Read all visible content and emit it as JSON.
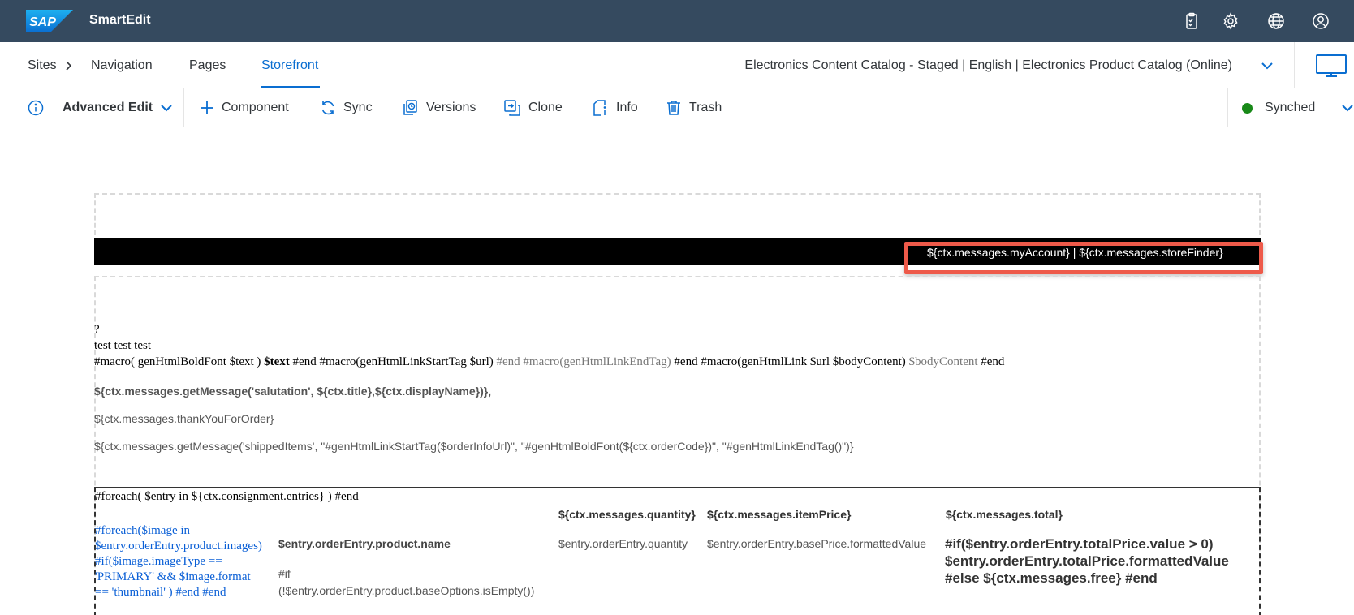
{
  "shell": {
    "logo_text": "SAP",
    "app_title": "SmartEdit",
    "icons": [
      "clipboard-icon",
      "settings-icon",
      "globe-icon",
      "user-icon"
    ]
  },
  "nav": {
    "sites": "Sites",
    "navigation": "Navigation",
    "pages": "Pages",
    "storefront": "Storefront",
    "catalog_info": "Electronics Content Catalog - Staged | English | Electronics Product Catalog (Online)"
  },
  "toolbar": {
    "mode": "Advanced Edit",
    "component": "Component",
    "sync": "Sync",
    "versions": "Versions",
    "clone": "Clone",
    "info": "Info",
    "trash": "Trash",
    "status": "Synched",
    "status_color": "#188918"
  },
  "storefront": {
    "header_links": "${ctx.messages.myAccount} | ${ctx.messages.storeFinder}",
    "line_q": "?",
    "line_test": "test test test",
    "macro_a": "#macro( genHtmlBoldFont $text ) ",
    "macro_b": "$text",
    "macro_c": " #end #macro(genHtmlLinkStartTag $url) ",
    "macro_d": "#end #macro(genHtmlLinkEndTag)",
    "macro_e": " #end #macro(genHtmlLink $url $bodyContent) ",
    "macro_f": "$bodyContent",
    "macro_g": " #end",
    "salutation": "${ctx.messages.getMessage('salutation', ${ctx.title},${ctx.displayName})},",
    "thank_you": "${ctx.messages.thankYouForOrder}",
    "shipped_items": "${ctx.messages.getMessage('shippedItems', \"#genHtmlLinkStartTag($orderInfoUrl)\", \"#genHtmlBoldFont(${ctx.orderCode})\", \"#genHtmlLinkEndTag()\")}",
    "foreach": "#foreach( $entry in ${ctx.consignment.entries} ) #end",
    "image_loop": [
      "#foreach($image in",
      "$entry.orderEntry.product.images)",
      "#if($image.imageType ==",
      "'PRIMARY' && $image.format",
      "== 'thumbnail' )  #end #end"
    ],
    "th_quantity": "${ctx.messages.quantity}",
    "th_item_price": "${ctx.messages.itemPrice}",
    "th_total": "${ctx.messages.total}",
    "product_name": "$entry.orderEntry.product.name",
    "quantity": "$entry.orderEntry.quantity",
    "base_price": "$entry.orderEntry.basePrice.formattedValue",
    "if_base_options": [
      "#if",
      "(!$entry.orderEntry.product.baseOptions.isEmpty())"
    ],
    "total_lines": [
      "#if($entry.orderEntry.totalPrice.value > 0)",
      "$entry.orderEntry.totalPrice.formattedValue",
      "#else ${ctx.messages.free} #end"
    ]
  }
}
